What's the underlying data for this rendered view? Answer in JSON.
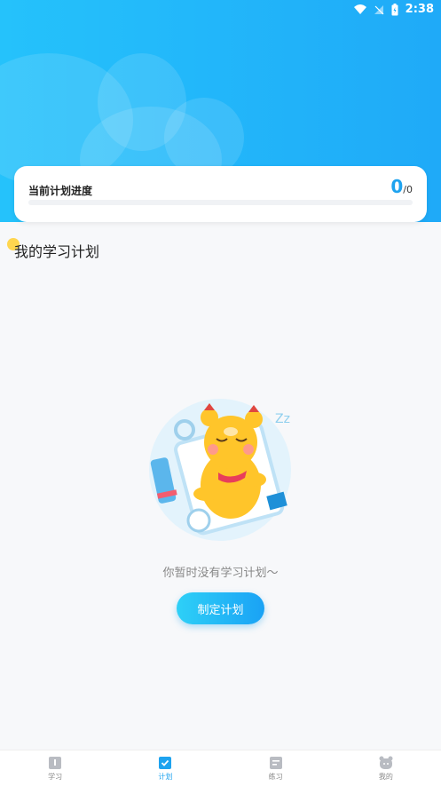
{
  "status": {
    "time": "2:38"
  },
  "progress": {
    "title": "当前计划进度",
    "current": "0",
    "total": "/0",
    "ratio": 0
  },
  "section": {
    "title": "我的学习计划"
  },
  "empty": {
    "message": "你暂时没有学习计划～",
    "button_label": "制定计划"
  },
  "nav": {
    "items": [
      {
        "label": "学习",
        "icon": "book-icon"
      },
      {
        "label": "计划",
        "icon": "plan-check-icon"
      },
      {
        "label": "练习",
        "icon": "practice-icon"
      },
      {
        "label": "我的",
        "icon": "profile-icon"
      }
    ],
    "active_index": 1
  },
  "colors": {
    "accent": "#1ea3ef",
    "header": "#1faaf8",
    "nav_inactive": "#888888"
  }
}
